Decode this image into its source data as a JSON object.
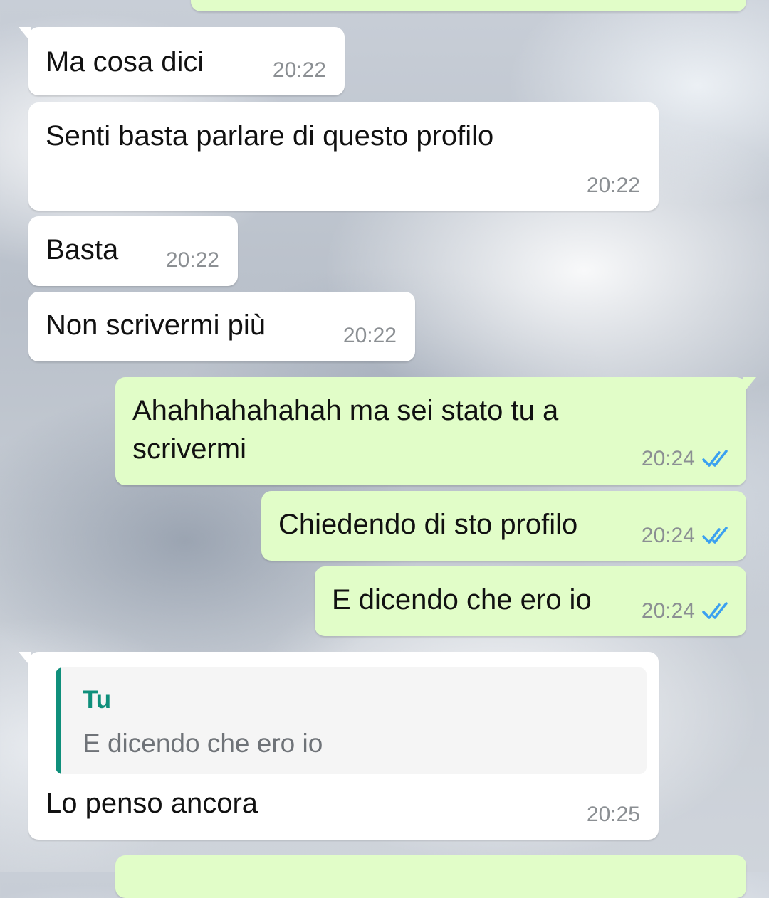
{
  "colors": {
    "incoming_bubble": "#ffffff",
    "outgoing_bubble": "#e1fdc8",
    "timestamp": "#8b8f93",
    "read_ticks": "#3aa0f0",
    "quote_accent": "#0f8f7b",
    "quote_background": "#f5f5f5"
  },
  "messages": [
    {
      "text": "Ma cosa dici",
      "time": "20:22"
    },
    {
      "text": "Senti basta parlare di questo profilo",
      "time": "20:22"
    },
    {
      "text": "Basta",
      "time": "20:22"
    },
    {
      "text": "Non scrivermi più",
      "time": "20:22"
    },
    {
      "text": "Ahahhahahahah ma sei stato tu a\nscrivermi",
      "time": "20:24",
      "status_icon": "double-check-icon"
    },
    {
      "text": "Chiedendo di sto profilo",
      "time": "20:24",
      "status_icon": "double-check-icon"
    },
    {
      "text": "E dicendo che ero io",
      "time": "20:24",
      "status_icon": "double-check-icon"
    },
    {
      "quote": {
        "author": "Tu",
        "text": "E dicendo che ero io"
      },
      "text": "Lo penso ancora",
      "time": "20:25"
    }
  ]
}
